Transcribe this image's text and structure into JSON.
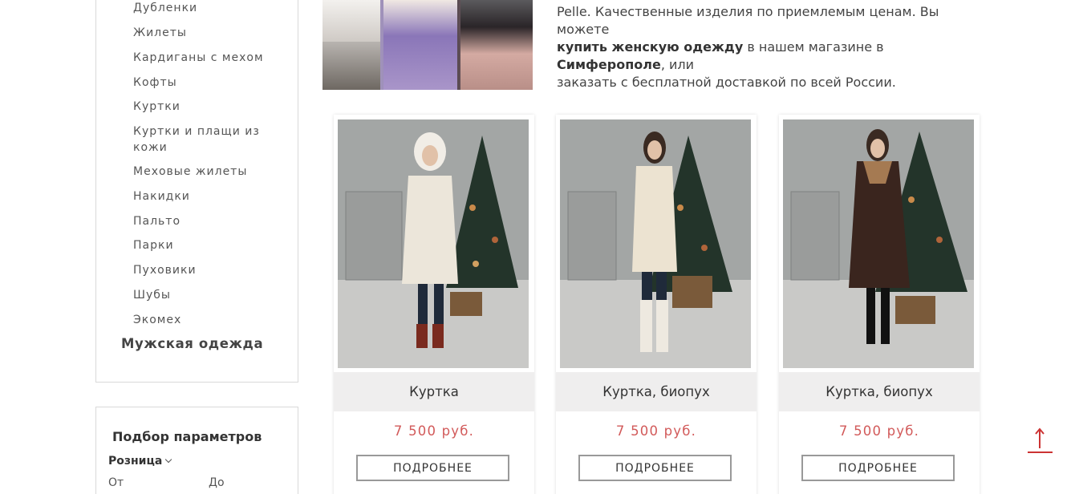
{
  "sidebar": {
    "categories": [
      "Дубленки",
      "Жилеты",
      "Кардиганы с мехом",
      "Кофты",
      "Куртки",
      "Куртки и плащи из кожи",
      "Меховые жилеты",
      "Накидки",
      "Пальто",
      "Парки",
      "Пуховики",
      "Шубы",
      "Экомех"
    ],
    "main_category": "Мужская одежда"
  },
  "filter": {
    "title": "Подбор параметров",
    "subsection": "Розница",
    "from_label": "От",
    "to_label": "До"
  },
  "intro": {
    "line1": "Pelle. Качественные изделия по приемлемым ценам. Вы можете",
    "bold1": "купить женскую одежду",
    "mid": " в нашем магазине в ",
    "bold2": "Симферополе",
    "tail": ", или",
    "line3": "заказать с бесплатной доставкой по всей России."
  },
  "products": [
    {
      "title": "Куртка",
      "price": "7 500 руб.",
      "button": "ПОДРОБНЕЕ"
    },
    {
      "title": "Куртка, биопух",
      "price": "7 500 руб.",
      "button": "ПОДРОБНЕЕ"
    },
    {
      "title": "Куртка, биопух",
      "price": "7 500 руб.",
      "button": "ПОДРОБНЕЕ"
    }
  ],
  "colors": {
    "price": "#d25a5a",
    "accent": "#cc3333"
  }
}
